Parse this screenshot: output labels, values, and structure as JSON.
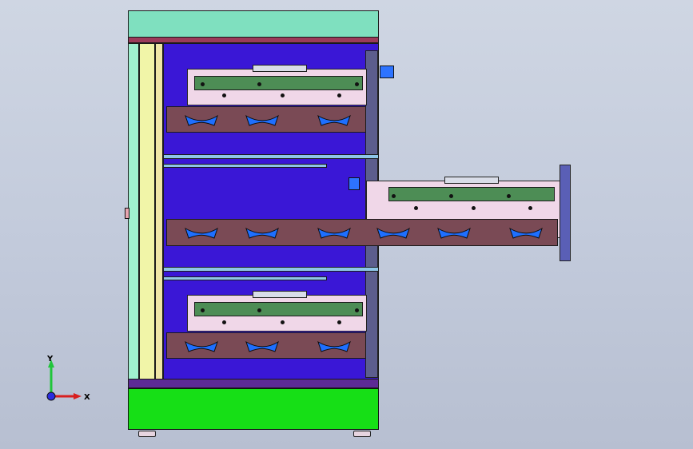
{
  "triad": {
    "x_label": "X",
    "y_label": "Y"
  },
  "colors": {
    "background": "#c6cede",
    "cabinet": "#3a17d6",
    "base": "#16df16"
  }
}
